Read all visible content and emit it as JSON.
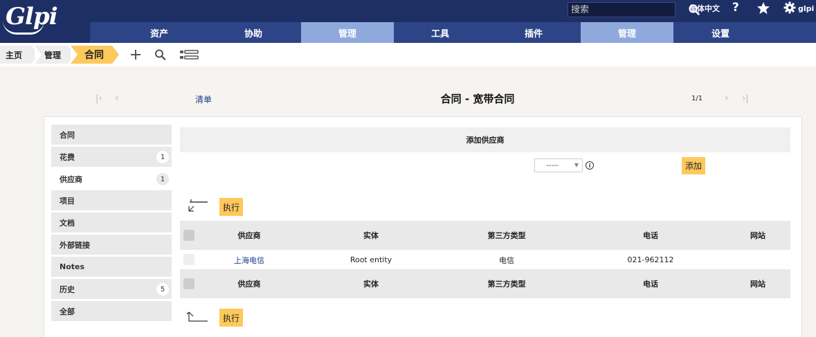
{
  "app": {
    "logo_text": "Glpi"
  },
  "topbar": {
    "search_placeholder": "搜索",
    "language": "简体中文",
    "help": "?",
    "user": "glpi"
  },
  "menu": [
    "资产",
    "协助",
    "管理",
    "工具",
    "插件",
    "管理",
    "设置"
  ],
  "breadcrumb": {
    "home": "主页",
    "parent": "管理",
    "current": "合同"
  },
  "nav": {
    "list_link": "清单",
    "title": "合同 - 宽带合同",
    "page_count": "1/1"
  },
  "tabs": [
    {
      "label": "合同",
      "badge": ""
    },
    {
      "label": "花费",
      "badge": "1"
    },
    {
      "label": "供应商",
      "badge": "1"
    },
    {
      "label": "项目",
      "badge": ""
    },
    {
      "label": "文档",
      "badge": ""
    },
    {
      "label": "外部链接",
      "badge": ""
    },
    {
      "label": "Notes",
      "badge": ""
    },
    {
      "label": "历史",
      "badge": "5"
    },
    {
      "label": "全部",
      "badge": ""
    }
  ],
  "add_supplier": {
    "header": "添加供应商",
    "select_value": "-----",
    "add_button": "添加"
  },
  "actions": {
    "execute": "执行"
  },
  "table": {
    "headers": [
      "供应商",
      "实体",
      "第三方类型",
      "电话",
      "网站"
    ],
    "rows": [
      [
        "上海电信",
        "Root entity",
        "电信",
        "021-962112",
        ""
      ]
    ]
  },
  "colors": {
    "topbar": "#1e2f66",
    "menubar": "#2d4487",
    "menu_active": "#8fa9dc",
    "accent": "#fec95c",
    "link": "#1e3a8a"
  }
}
